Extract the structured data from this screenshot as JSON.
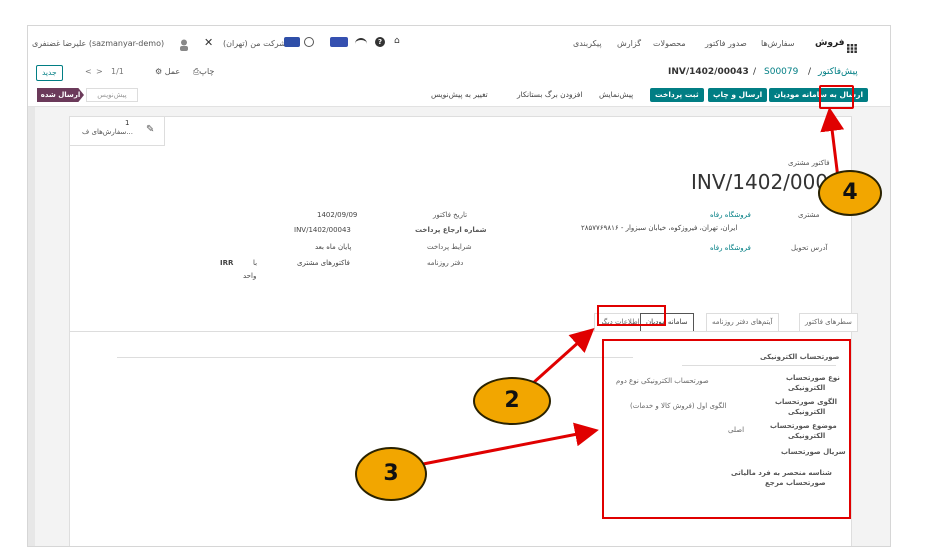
{
  "topbar": {
    "app": "فروش",
    "menu": [
      "سفارش‌ها",
      "صدور فاکتور",
      "محصولات",
      "گزارش",
      "پیکربندی"
    ],
    "company": "شرکت من (تهران)",
    "user": "علیرضا غضنفری (sazmanyar-demo)"
  },
  "breadcrumb": {
    "root": "پیش‌فاکتور",
    "sep1": "/",
    "order": "S00079",
    "sep2": "/",
    "current": "INV/1402/00043"
  },
  "pager": {
    "value": "1/1",
    "prev": "<",
    "next": ">",
    "new_btn": "جدید"
  },
  "actions_menu": {
    "print": "چاپ",
    "action": "عمل"
  },
  "buttons": {
    "send_moadian": "ارسال به سامانه مودیان",
    "send_print": "ارسال و چاپ",
    "register_payment": "ثبت پرداخت",
    "preview": "پیش‌نمایش",
    "add_credit_note": "افزودن برگ بستانکار",
    "reset_draft": "تغییر به پیش‌نویس"
  },
  "status": {
    "draft": "پیش‌نویس",
    "sent": "ارسال شده"
  },
  "smart_button": {
    "count": "1",
    "label": "سفارش‌های ف..."
  },
  "invoice": {
    "type_label": "فاکتور مشتری",
    "number": "INV/1402/00042",
    "customer_label": "مشتری",
    "customer": "فروشگاه رفاه",
    "address": "ایران، تهران، فیروزکوه، خیابان سبزوار - ۲۸۵۷۷۶۹۸۱۶",
    "delivery_label": "آدرس تحویل",
    "delivery": "فروشگاه رفاه",
    "date_label": "تاریخ فاکتور",
    "date": "1402/09/09",
    "payref_label": "شماره ارجاع پرداخت",
    "payref": "INV/1402/00043",
    "terms_label": "شرایط پرداخت",
    "terms": "پایان ماه بعد",
    "journal_label": "دفتر روزنامه",
    "journal": "فاکتورهای مشتری",
    "currency_prefix": "با",
    "currency": "IRR",
    "currency_suffix": "واحد"
  },
  "tabs": [
    "سطرهای فاکتور",
    "آیتم‌های دفتر روزنامه",
    "سامانه مودیان",
    "اطلاعات دیگر"
  ],
  "moadian": {
    "section_title": "صورتحساب الکترونیکی",
    "type_label_1": "نوع صورتحساب",
    "type_label_2": "الکترونیکی",
    "type_value": "صورتحساب الکترونیکی نوع دوم",
    "pattern_label_1": "الگوی صورتحساب",
    "pattern_label_2": "الکترونیکی",
    "pattern_value": "الگوی اول (فروش کالا و خدمات)",
    "subject_label_1": "موضوع صورتحساب",
    "subject_label_2": "الکترونیکی",
    "subject_value": "اصلی",
    "serial_label": "سریال صورتحساب",
    "unique_label_1": "شناسه منحصر به فرد مالیاتی",
    "unique_label_2": "صورتحساب مرجع"
  },
  "annotations": [
    "2",
    "3",
    "4"
  ],
  "colors": {
    "primary": "#017e84",
    "annotation": "#e00000",
    "badge": "#f2a600",
    "status_active": "#6b3a5a"
  }
}
